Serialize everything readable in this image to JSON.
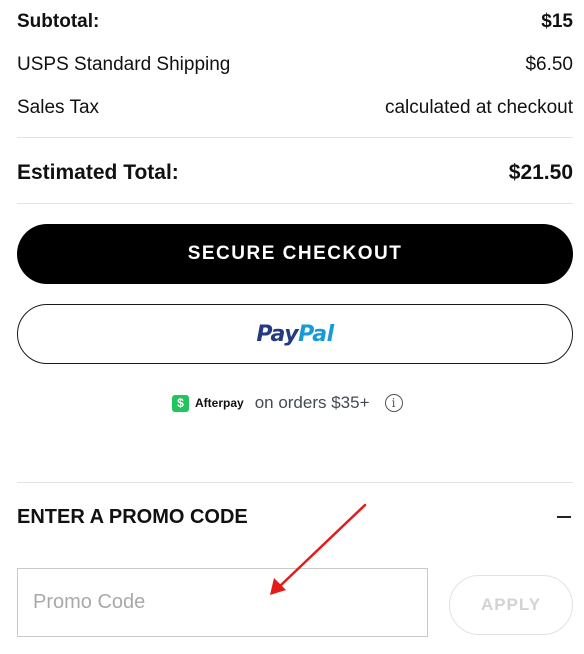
{
  "summary": {
    "subtotal_label": "Subtotal:",
    "subtotal_value": "$15",
    "shipping_label": "USPS Standard Shipping",
    "shipping_value": "$6.50",
    "tax_label": "Sales Tax",
    "tax_value": "calculated at checkout",
    "total_label": "Estimated Total:",
    "total_value": "$21.50"
  },
  "checkout": {
    "secure_label": "SECURE CHECKOUT",
    "paypal_pay": "Pay",
    "paypal_pal": "Pal"
  },
  "afterpay": {
    "badge_glyph": "$",
    "brand": "Afterpay",
    "note": "on orders $35+",
    "info_glyph": "i"
  },
  "promo": {
    "heading": "ENTER A PROMO CODE",
    "placeholder": "Promo Code",
    "value": "",
    "apply_label": "APPLY",
    "apply_enabled": false
  },
  "colors": {
    "checkout_bg": "#000000",
    "paypal_dark": "#253b80",
    "paypal_light": "#179bd7",
    "afterpay_green": "#21c55d",
    "annotation_arrow": "#e31b1b"
  },
  "icons": [
    "afterpay-logo-icon",
    "info-icon",
    "minus-icon",
    "annotation-arrow-icon"
  ]
}
